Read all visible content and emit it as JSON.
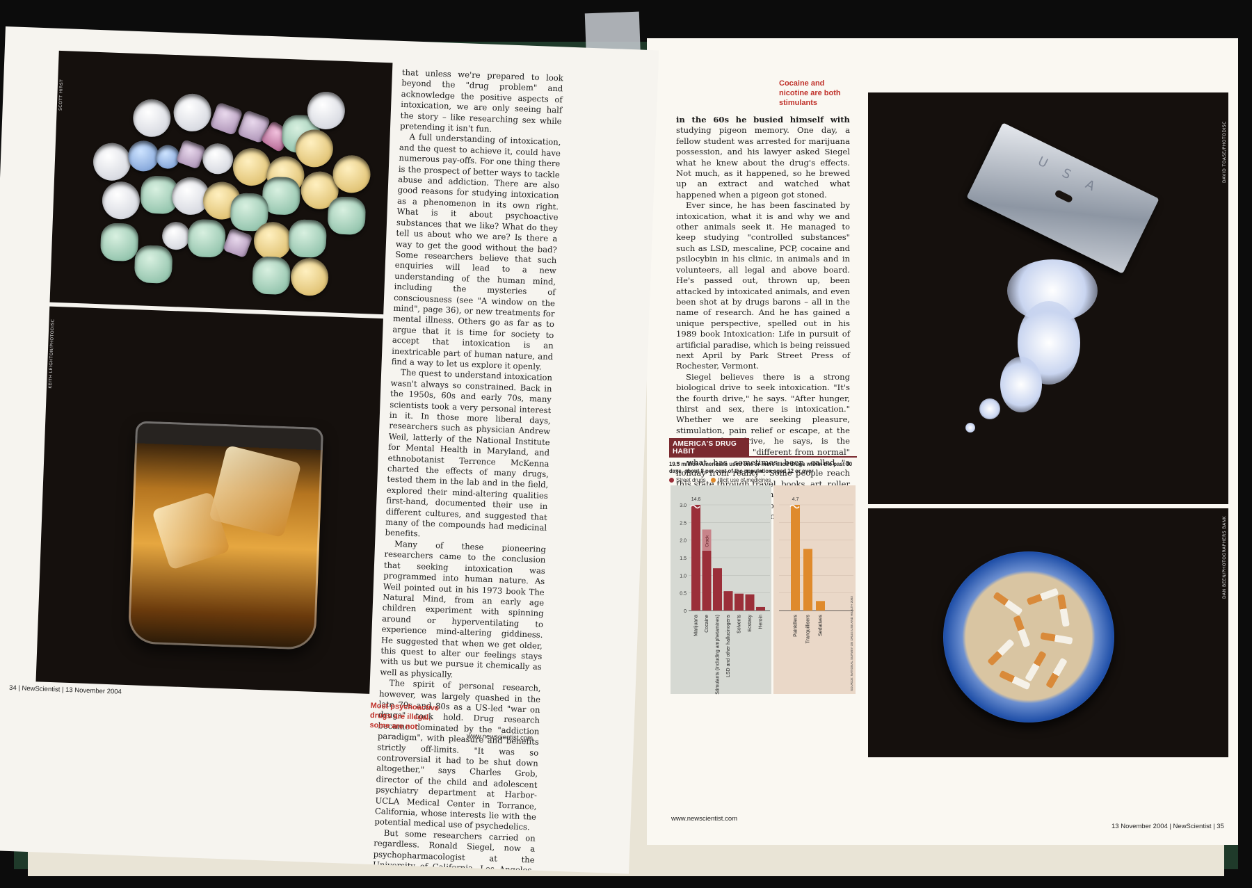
{
  "left_page": {
    "photo_credits": [
      "SCOTT HIRST",
      "KEITH LEIGHTON/PHOTODISC"
    ],
    "paragraphs": [
      "that unless we're prepared to look beyond the \"drug problem\" and acknowledge the positive aspects of intoxication, we are only seeing half the story – like researching sex while pretending it isn't fun.",
      "A full understanding of intoxication, and the quest to achieve it, could have numerous pay-offs. For one thing there is the prospect of better ways to tackle abuse and addiction. There are also good reasons for studying intoxication as a phenomenon in its own right. What is it about psychoactive substances that we like? What do they tell us about who we are? Is there a way to get the good without the bad? Some researchers believe that such enquiries will lead to a new understanding of the human mind, including the mysteries of consciousness (see \"A window on the mind\", page 36), or new treatments for mental illness. Others go as far as to argue that it is time for society to accept that intoxication is an inextricable part of human nature, and find a way to let us explore it openly.",
      "The quest to understand intoxication wasn't always so constrained. Back in the 1950s, 60s and early 70s, many scientists took a very personal interest in it. In those more liberal days, researchers such as physician Andrew Weil, latterly of the National Institute for Mental Health in Maryland, and ethnobotanist Terrence McKenna charted the effects of many drugs, tested them in the lab and in the field, explored their mind-altering qualities first-hand, documented their use in different cultures, and suggested that many of the compounds had medicinal benefits.",
      "Many of these pioneering researchers came to the conclusion that seeking intoxication was programmed into human nature. As Weil pointed out in his 1973 book The Natural Mind, from an early age children experiment with spinning around or hyperventilating to experience mind-altering giddiness. He suggested that when we get older, this quest to alter our feelings stays with us but we pursue it chemically as well as physically.",
      "The spirit of personal research, however, was largely quashed in the late 70s and 80s as a US-led \"war on drugs\" took hold. Drug research became dominated by the \"addiction paradigm\", with pleasure and benefits strictly off-limits. \"It was so controversial it had to be shut down altogether,\" says Charles Grob, director of the child and adolescent psychiatry department at Harbor-UCLA Medical Center in Torrance, California, whose interests lie with the potential medical use of psychedelics.",
      "But some researchers carried on regardless. Ronald Siegel, now a psychopharmacologist at the University of California, Los Angeles, was one of them. As a psychology graduate student"
    ],
    "caption": "Most psychoactive drugs are illegal, some are not",
    "folio": "34 | NewScientist | 13 November 2004",
    "url": "www.newscientist.com"
  },
  "right_page": {
    "caption": "Cocaine and nicotine are both stimulants",
    "photo_credits": [
      "DAVID TOASE/PHOTODISC",
      "DAN BEEN/PHOTOGRAPHERS BANK"
    ],
    "razor_text": "U S A",
    "paragraphs": [
      "in the 60s he busied himself with studying pigeon memory. One day, a fellow student was arrested for marijuana possession, and his lawyer asked Siegel what he knew about the drug's effects. Not much, as it happened, so he brewed up an extract and watched what happened when a pigeon got stoned.",
      "Ever since, he has been fascinated by intoxication, what it is and why we and other animals seek it. He managed to keep studying \"controlled substances\" such as LSD, mescaline, PCP, cocaine and psilocybin in his clinic, in animals and in volunteers, all legal and above board. He's passed out, thrown up, been attacked by intoxicated animals, and even been shot at by drugs barons – all in the name of research. And he has gained a unique perspective, spelled out in his 1989 book Intoxication: Life in pursuit of artificial paradise, which is being reissued next April by Park Street Press of Rochester, Vermont.",
      "Siegel believes there is a strong biological drive to seek intoxication. \"It's the fourth drive,\" he says. \"After hunger, thirst and sex, there is intoxication.\" Whether we are seeking pleasure, stimulation, pain relief or escape, at the root of this drive, he says, is the motivation to feel \"different from normal\" – what has sometimes been called \"a holiday from reality\". Some people reach this state through travel, books, art, roller coasters, sport, religion, exploration, love, social contact or power. Others use intoxicants. \"It's the same ▶"
    ],
    "folio": "13 November 2004 | NewScientist | 35",
    "url": "www.newscientist.com"
  },
  "chart_data": {
    "type": "bar",
    "title": "AMERICA'S DRUG HABIT",
    "subtitle": "19.5 million Americans used one or more illicit drugs within the past 30 days, about 8 per cent of the population aged 12 or over",
    "legend": [
      "Street drugs",
      "Illicit use of medicines"
    ],
    "colors": {
      "Street drugs": "#9b2f39",
      "Illicit use of medicines": "#df8a2c"
    },
    "ylim": [
      0,
      3.0
    ],
    "yticks": [
      "0",
      "0.5",
      "1.0",
      "1.5",
      "2.0",
      "2.5",
      "3.0"
    ],
    "series": [
      {
        "name": "Street drugs",
        "categories": [
          "Marijuana",
          "Cocaine",
          "Stimulants (including amphetamines)",
          "LSD and other hallucinogens",
          "Solvents",
          "Ecstasy",
          "Heroin"
        ],
        "values": [
          14.6,
          1.7,
          1.2,
          0.55,
          0.48,
          0.46,
          0.1
        ],
        "labels": [
          "14.6",
          "",
          "",
          "",
          "",
          "",
          ""
        ]
      },
      {
        "name": "Illicit use of medicines",
        "categories": [
          "Painkillers",
          "Tranquillisers",
          "Sedatives"
        ],
        "values": [
          4.7,
          1.75,
          0.27
        ],
        "labels": [
          "4.7",
          "",
          ""
        ]
      }
    ],
    "annotation": "Crack",
    "source": "SOURCE: NATIONAL SURVEY ON DRUG USE AND HEALTH 2003"
  }
}
